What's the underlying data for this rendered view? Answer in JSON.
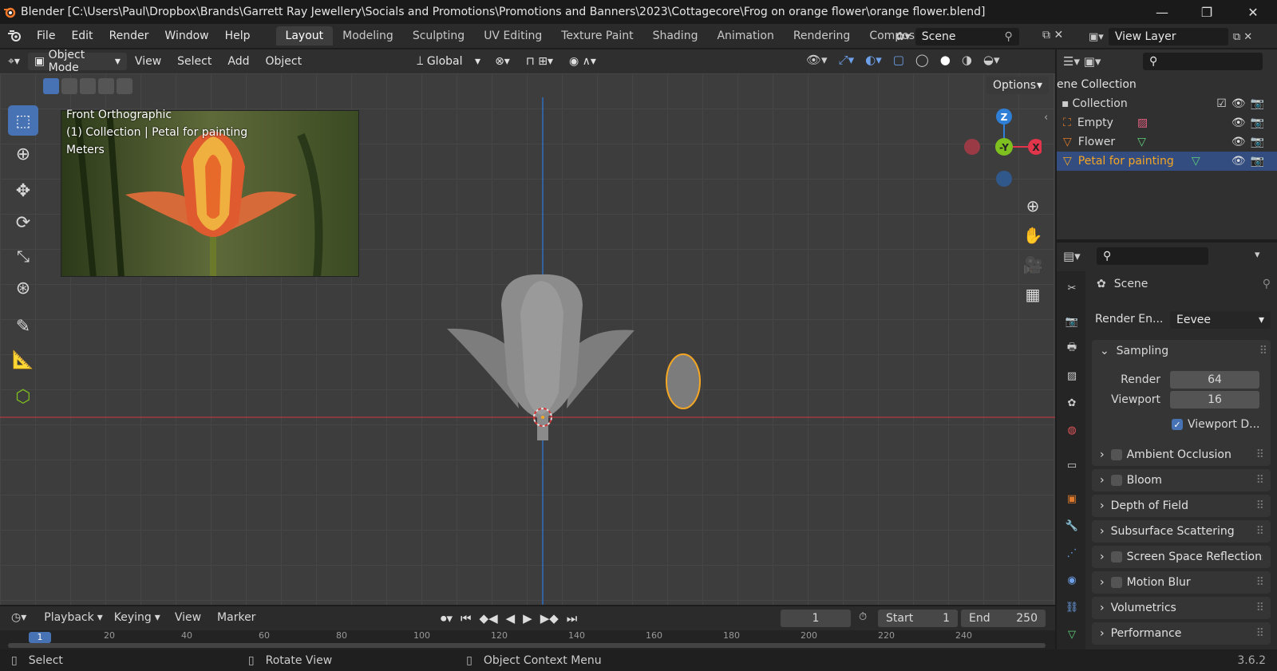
{
  "window": {
    "title": "Blender [C:\\Users\\Paul\\Dropbox\\Brands\\Garrett Ray Jewellery\\Socials and Promotions\\Promotions and Banners\\2023\\Cottagecore\\Frog on orange flower\\orange flower.blend]",
    "minimize": "—",
    "restore": "❐",
    "close": "✕"
  },
  "menu": {
    "items": [
      "File",
      "Edit",
      "Render",
      "Window",
      "Help"
    ]
  },
  "workspaces": [
    "Layout",
    "Modeling",
    "Sculpting",
    "UV Editing",
    "Texture Paint",
    "Shading",
    "Animation",
    "Rendering",
    "Compositin"
  ],
  "scene": {
    "name": "Scene"
  },
  "view_layer": {
    "name": "View Layer"
  },
  "viewport_header": {
    "mode": "Object Mode",
    "view": "View",
    "select": "Select",
    "add": "Add",
    "object": "Object",
    "orientation": "Global",
    "options": "Options"
  },
  "viewport": {
    "view_name": "Front Orthographic",
    "collection_info": "(1) Collection | Petal for painting",
    "units": "Meters",
    "gizmo": {
      "z": "Z",
      "y": "-Y",
      "x": "X"
    }
  },
  "outliner": {
    "header": "ene Collection",
    "rows": [
      {
        "name": "Collection"
      },
      {
        "name": "Empty"
      },
      {
        "name": "Flower"
      },
      {
        "name": "Petal for painting"
      }
    ]
  },
  "properties": {
    "scene_label": "Scene",
    "render_engine_label": "Render En...",
    "render_engine": "Eevee",
    "sampling": {
      "title": "Sampling",
      "render_label": "Render",
      "render_value": "64",
      "viewport_label": "Viewport",
      "viewport_value": "16",
      "viewport_denoise": "Viewport D..."
    },
    "panels": [
      {
        "label": "Ambient Occlusion",
        "checkbox": true
      },
      {
        "label": "Bloom",
        "checkbox": true
      },
      {
        "label": "Depth of Field",
        "checkbox": false
      },
      {
        "label": "Subsurface Scattering",
        "checkbox": false
      },
      {
        "label": "Screen Space Reflections",
        "checkbox": true
      },
      {
        "label": "Motion Blur",
        "checkbox": true
      },
      {
        "label": "Volumetrics",
        "checkbox": false
      },
      {
        "label": "Performance",
        "checkbox": false
      }
    ]
  },
  "timeline": {
    "playback": "Playback",
    "keying": "Keying",
    "view": "View",
    "marker": "Marker",
    "current_frame": "1",
    "start_label": "Start",
    "start": "1",
    "end_label": "End",
    "end": "250",
    "ruler": [
      "1",
      "20",
      "40",
      "60",
      "80",
      "100",
      "120",
      "140",
      "160",
      "180",
      "200",
      "220",
      "240"
    ]
  },
  "statusbar": {
    "select": "Select",
    "rotate": "Rotate View",
    "context": "Object Context Menu",
    "version": "3.6.2"
  },
  "colors": {
    "accent": "#4772b3",
    "selection_orange": "#f5a623",
    "z_axis": "#2f7fd6",
    "y_axis": "#7ec020",
    "x_axis": "#e0354b"
  }
}
